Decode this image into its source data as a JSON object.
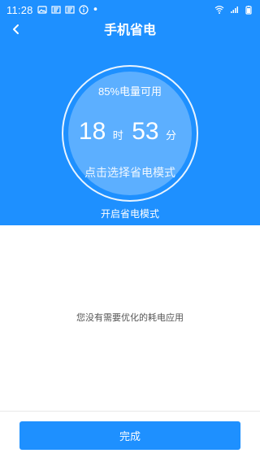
{
  "status_bar": {
    "time": "11:28",
    "indicator_text": "•",
    "icons": [
      "image-icon",
      "notification-icon",
      "notification-icon",
      "info-icon",
      "wifi-icon",
      "signal-icon",
      "battery-icon"
    ]
  },
  "header": {
    "title": "手机省电",
    "back_icon": "chevron-left-icon"
  },
  "battery": {
    "status_text": "85%电量可用",
    "hours": "18",
    "hours_unit": "时",
    "minutes": "53",
    "minutes_unit": "分",
    "select_mode_text": "点击选择省电模式"
  },
  "enable_mode_label": "开启省电模式",
  "empty_message": "您没有需要优化的耗电应用",
  "done_button_label": "完成",
  "colors": {
    "primary": "#1e90ff",
    "background": "#ffffff",
    "muted_text": "#555555"
  }
}
